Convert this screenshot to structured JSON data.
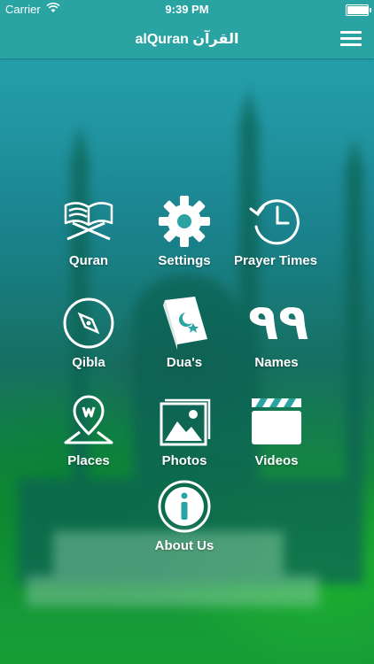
{
  "status_bar": {
    "carrier": "Carrier",
    "time": "9:39 PM",
    "battery_level": 0.95,
    "wifi_icon": "wifi-icon",
    "battery_icon": "battery-icon"
  },
  "navbar": {
    "title": "alQuran القرآن",
    "menu_icon": "hamburger-menu-icon"
  },
  "menu": {
    "quran": {
      "label": "Quran",
      "icon": "open-quran-book-icon"
    },
    "settings": {
      "label": "Settings",
      "icon": "gear-icon"
    },
    "prayer_times": {
      "label": "Prayer Times",
      "icon": "clock-history-icon"
    },
    "qibla": {
      "label": "Qibla",
      "icon": "compass-icon"
    },
    "duas": {
      "label": "Dua's",
      "icon": "prayer-book-icon"
    },
    "names": {
      "label": "Names",
      "icon": "arabic-99-icon",
      "glyph": "٩٩"
    },
    "places": {
      "label": "Places",
      "icon": "map-pin-icon"
    },
    "photos": {
      "label": "Photos",
      "icon": "photo-gallery-icon"
    },
    "videos": {
      "label": "Videos",
      "icon": "clapperboard-icon"
    },
    "about": {
      "label": "About Us",
      "icon": "info-icon"
    }
  },
  "colors": {
    "bar": "#2aa3a3",
    "foreground": "#ffffff"
  }
}
